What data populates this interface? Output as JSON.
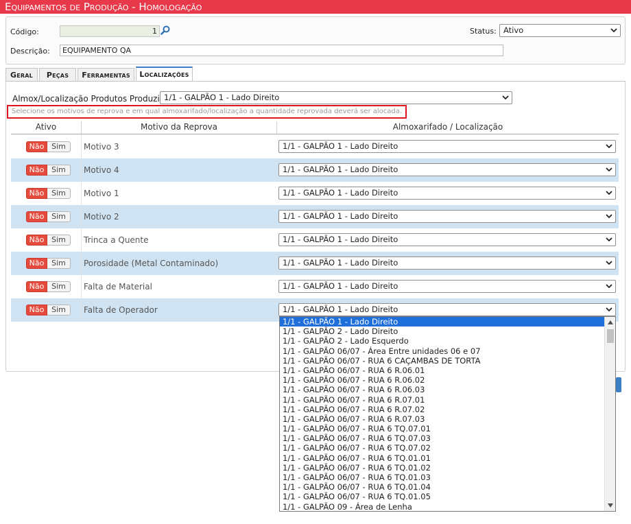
{
  "header": {
    "title": "Equipamentos de Produção  - Homologação"
  },
  "form": {
    "codigo_label": "Código:",
    "codigo_value": "1",
    "status_label": "Status:",
    "status_value": "Ativo",
    "descricao_label": "Descrição:",
    "descricao_value": "EQUIPAMENTO QA"
  },
  "tabs": [
    {
      "label": "Geral",
      "active": false
    },
    {
      "label": "Peças",
      "active": false
    },
    {
      "label": "Ferramentas",
      "active": false
    },
    {
      "label": "Localizações",
      "active": true
    }
  ],
  "localizacoes": {
    "almox_label": "Almox/Localização Produtos Produzidos:",
    "almox_value": "1/1 - GALPÃO 1 - Lado Direito",
    "hint": "Selecione os motivos de reprova e em qual almoxarifado/localização a quantidade reprovada deverá ser alocada.",
    "columns": [
      "Ativo",
      "Motivo da Reprova",
      "Almoxarifado / Localização"
    ],
    "toggle_off": "Não",
    "toggle_on": "Sim",
    "rows": [
      {
        "motivo": "Motivo 3",
        "local": "1/1 - GALPÃO 1 - Lado Direito"
      },
      {
        "motivo": "Motivo 4",
        "local": "1/1 - GALPÃO 1 - Lado Direito"
      },
      {
        "motivo": "Motivo 1",
        "local": "1/1 - GALPÃO 1 - Lado Direito"
      },
      {
        "motivo": "Motivo 2",
        "local": "1/1 - GALPÃO 1 - Lado Direito"
      },
      {
        "motivo": "Trinca a Quente",
        "local": "1/1 - GALPÃO 1 - Lado Direito"
      },
      {
        "motivo": "Porosidade (Metal Contaminado)",
        "local": "1/1 - GALPÃO 1 - Lado Direito"
      },
      {
        "motivo": "Falta de Material",
        "local": "1/1 - GALPÃO 1 - Lado Direito"
      },
      {
        "motivo": "Falta de Operador",
        "local": "1/1 - GALPÃO 1 - Lado Direito"
      }
    ],
    "dropdown_options": [
      "1/1 - GALPÃO 1 - Lado Direito",
      "1/1 - GALPÃO 2 - Lado Direito",
      "1/1 - GALPÃO 2 - Lado Esquerdo",
      "1/1 - GALPÃO 06/07 - Área Entre unidades 06 e 07",
      "1/1 - GALPÃO 06/07 - RUA 6 CAÇAMBAS DE TORTA",
      "1/1 - GALPÃO 06/07 - RUA 6 R.06.01",
      "1/1 - GALPÃO 06/07 - RUA 6 R.06.02",
      "1/1 - GALPÃO 06/07 - RUA 6 R.06.03",
      "1/1 - GALPÃO 06/07 - RUA 6 R.07.01",
      "1/1 - GALPÃO 06/07 - RUA 6 R.07.02",
      "1/1 - GALPÃO 06/07 - RUA 6 R.07.03",
      "1/1 - GALPÃO 06/07 - RUA 6 TQ.07.01",
      "1/1 - GALPÃO 06/07 - RUA 6 TQ.07.03",
      "1/1 - GALPÃO 06/07 - RUA 6 TQ.07.02",
      "1/1 - GALPÃO 06/07 - RUA 6 TQ.01.01",
      "1/1 - GALPÃO 06/07 - RUA 6 TQ.01.02",
      "1/1 - GALPÃO 06/07 - RUA 6 TQ.01.03",
      "1/1 - GALPÃO 06/07 - RUA 6 TQ.01.04",
      "1/1 - GALPÃO 06/07 - RUA 6 TQ.01.05",
      "1/1 - GALPÃO 09 - Área de Lenha"
    ],
    "dropdown_selected": "1/1 - GALPÃO 1 - Lado Direito"
  },
  "icons": {
    "search": "search-icon",
    "chevron": "chevron-down-icon"
  },
  "colors": {
    "header": "#e8394a",
    "toggle_off": "#e64a3c",
    "row_alt": "#cfe3f2",
    "highlight": "#e0141e",
    "selected_option": "#1e6fd9"
  }
}
